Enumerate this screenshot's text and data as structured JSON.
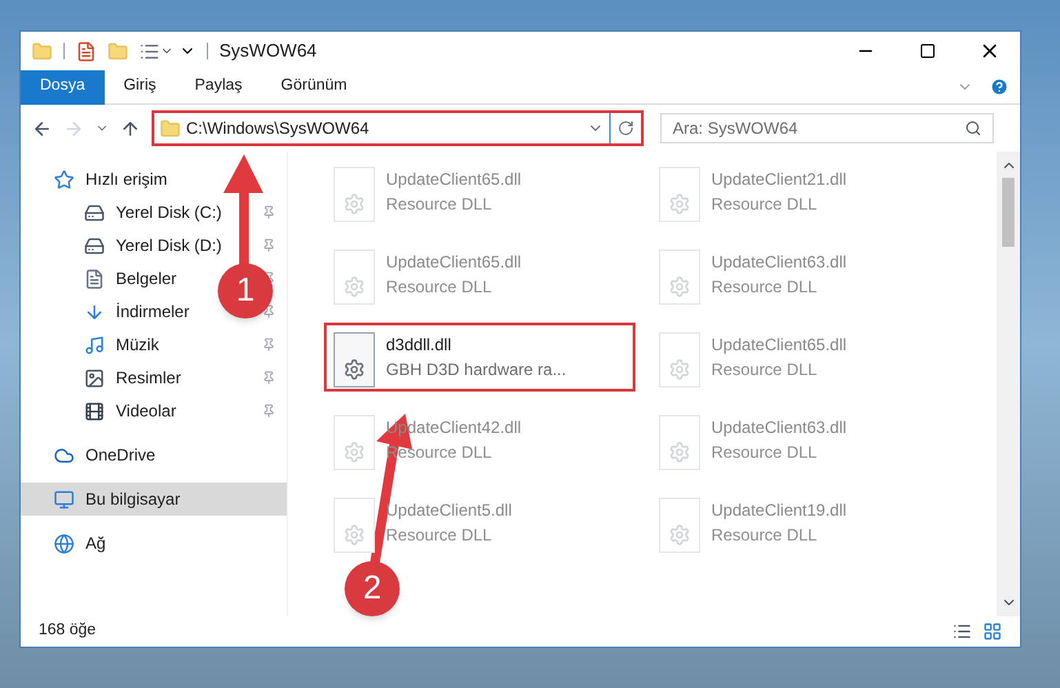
{
  "window": {
    "title": "SysWOW64"
  },
  "ribbon_tabs": [
    {
      "label": "Dosya",
      "selected": true
    },
    {
      "label": "Giriş",
      "selected": false
    },
    {
      "label": "Paylaş",
      "selected": false
    },
    {
      "label": "Görünüm",
      "selected": false
    }
  ],
  "address_bar": {
    "value": "C:\\Windows\\SysWOW64",
    "highlighted": true
  },
  "search": {
    "placeholder": "Ara: SysWOW64"
  },
  "sidebar": {
    "items": [
      {
        "kind": "star",
        "label": "Hızlı erişim",
        "selected": false,
        "children": [
          {
            "kind": "disk-c",
            "label": "Yerel Disk (C:)",
            "pinned": true,
            "selected": false
          },
          {
            "kind": "disk",
            "label": "Yerel Disk (D:)",
            "pinned": true,
            "selected": false
          },
          {
            "kind": "docs",
            "label": "Belgeler",
            "pinned": true,
            "selected": false
          },
          {
            "kind": "download",
            "label": "İndirmeler",
            "pinned": true,
            "selected": false
          },
          {
            "kind": "music",
            "label": "Müzik",
            "pinned": true,
            "selected": false
          },
          {
            "kind": "pictures",
            "label": "Resimler",
            "pinned": true,
            "selected": false
          },
          {
            "kind": "videos",
            "label": "Videolar",
            "pinned": true,
            "selected": false
          }
        ]
      },
      {
        "kind": "cloud",
        "label": "OneDrive",
        "selected": false
      },
      {
        "kind": "pc",
        "label": "Bu bilgisayar",
        "selected": true
      },
      {
        "kind": "network",
        "label": "Ağ",
        "selected": false
      }
    ]
  },
  "files": [
    {
      "name": "UpdateClient65.dll",
      "type": "Resource DLL",
      "faded": true,
      "highlighted": false
    },
    {
      "name": "UpdateClient21.dll",
      "type": "Resource DLL",
      "faded": true,
      "highlighted": false
    },
    {
      "name": "UpdateClient65.dll",
      "type": "Resource DLL",
      "faded": true,
      "highlighted": false
    },
    {
      "name": "UpdateClient63.dll",
      "type": "Resource DLL",
      "faded": true,
      "highlighted": false
    },
    {
      "name": "d3ddll.dll",
      "type": "GBH D3D hardware ra...",
      "faded": false,
      "highlighted": true
    },
    {
      "name": "UpdateClient65.dll",
      "type": "Resource DLL",
      "faded": true,
      "highlighted": false
    },
    {
      "name": "UpdateClient42.dll",
      "type": "Resource DLL",
      "faded": true,
      "highlighted": false
    },
    {
      "name": "UpdateClient63.dll",
      "type": "Resource DLL",
      "faded": true,
      "highlighted": false
    },
    {
      "name": "UpdateClient5.dll",
      "type": "Resource DLL",
      "faded": true,
      "highlighted": false
    },
    {
      "name": "UpdateClient19.dll",
      "type": "Resource DLL",
      "faded": true,
      "highlighted": false
    }
  ],
  "status_bar": {
    "count": "168 öğe"
  },
  "callouts": [
    {
      "number": "1"
    },
    {
      "number": "2"
    }
  ]
}
